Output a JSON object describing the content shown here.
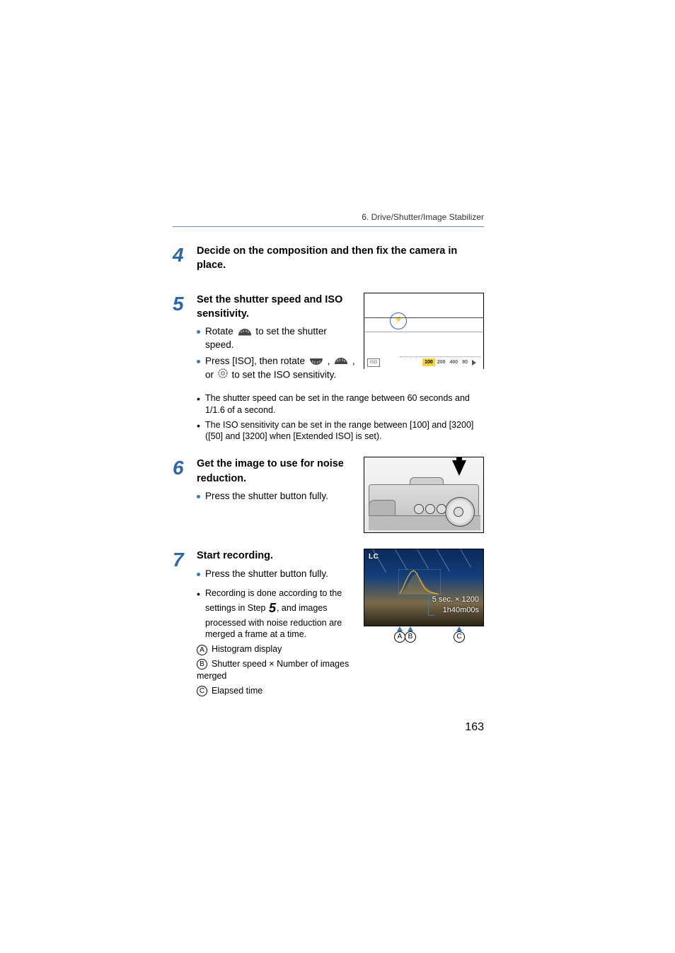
{
  "header": {
    "breadcrumb": "6. Drive/Shutter/Image Stabilizer"
  },
  "steps": {
    "s4": {
      "num": "4",
      "title": "Decide on the composition and then fix the camera in place."
    },
    "s5": {
      "num": "5",
      "title": "Set the shutter speed and ISO sensitivity.",
      "b1_a": "Rotate",
      "b1_b": "to set the shutter speed.",
      "b2_a": "Press [ISO], then rotate",
      "b2_b": ",",
      "b2_c": ", or",
      "b2_d": "to set the ISO sensitivity.",
      "n1": "The shutter speed can be set in the range between 60 seconds and 1/1.6 of a second.",
      "n2": "The ISO sensitivity can be set in the range between [100] and [3200] ([50] and [3200] when [Extended ISO] is set).",
      "fig": {
        "iso_label": "ISO",
        "flash": "⚡",
        "scale": [
          "100",
          "200",
          "400",
          "80"
        ]
      }
    },
    "s6": {
      "num": "6",
      "title": "Get the image to use for noise reduction.",
      "b1": "Press the shutter button fully."
    },
    "s7": {
      "num": "7",
      "title": "Start recording.",
      "b1": "Press the shutter button fully.",
      "n1_a": "Recording is done according to the settings in Step",
      "n1_step": "5",
      "n1_b": ", and images processed with noise reduction are merged a frame at a time.",
      "refA": "Histogram display",
      "refB": "Shutter speed × Number of images merged",
      "refC": "Elapsed time",
      "fig": {
        "lc": "LC",
        "line1": "5 sec. × 1200",
        "line2": "1h40m00s",
        "lblA": "A",
        "lblB": "B",
        "lblC": "C"
      }
    }
  },
  "labels": {
    "A": "A",
    "B": "B",
    "C": "C"
  },
  "page_number": "163"
}
